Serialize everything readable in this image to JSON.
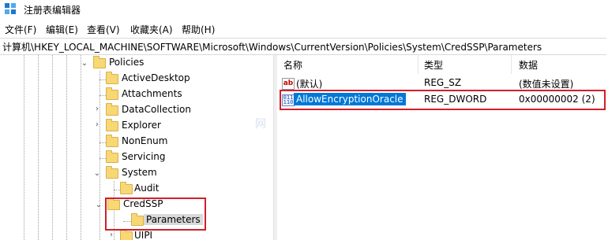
{
  "window": {
    "title": "注册表编辑器",
    "icon": "registry-editor-icon"
  },
  "menu": [
    "文件(F)",
    "编辑(E)",
    "查看(V)",
    "收藏夹(A)",
    "帮助(H)"
  ],
  "address": {
    "path": "计算机\\HKEY_LOCAL_MACHINE\\SOFTWARE\\Microsoft\\Windows\\CurrentVersion\\Policies\\System\\CredSSP\\Parameters"
  },
  "tree": {
    "nodes": [
      {
        "label": "Policies",
        "expanded": true
      },
      {
        "label": "ActiveDesktop"
      },
      {
        "label": "Attachments"
      },
      {
        "label": "DataCollection",
        "collapsed_arrow": true
      },
      {
        "label": "Explorer",
        "collapsed_arrow": true
      },
      {
        "label": "NonEnum"
      },
      {
        "label": "Servicing"
      },
      {
        "label": "System",
        "expanded": true
      },
      {
        "label": "Audit"
      },
      {
        "label": "CredSSP",
        "expanded": true
      },
      {
        "label": "Parameters",
        "selected": true
      },
      {
        "label": "UIPI",
        "collapsed_arrow": true
      }
    ]
  },
  "list": {
    "columns": [
      "名称",
      "类型",
      "数据"
    ],
    "rows": [
      {
        "name": "(默认)",
        "type": "REG_SZ",
        "data": "(数值未设置)",
        "icon": "string-value-icon"
      },
      {
        "name": "AllowEncryptionOracle",
        "type": "REG_DWORD",
        "data": "0x00000002 (2)",
        "icon": "binary-value-icon",
        "selected": true
      }
    ]
  },
  "colors": {
    "highlight_box": "#d11f2a",
    "selection": "#0078d7",
    "folder": "#f8d775"
  }
}
